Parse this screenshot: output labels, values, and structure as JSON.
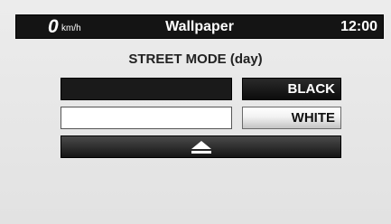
{
  "status_bar": {
    "speed_value": "0",
    "speed_unit": "km/h",
    "title": "Wallpaper",
    "clock": "12:00"
  },
  "mode_label": "STREET MODE (day)",
  "options": [
    {
      "label": "BLACK",
      "swatch_color": "#1a1a1a"
    },
    {
      "label": "WHITE",
      "swatch_color": "#ffffff"
    }
  ],
  "up_button": {
    "icon": "eject-up-icon"
  }
}
